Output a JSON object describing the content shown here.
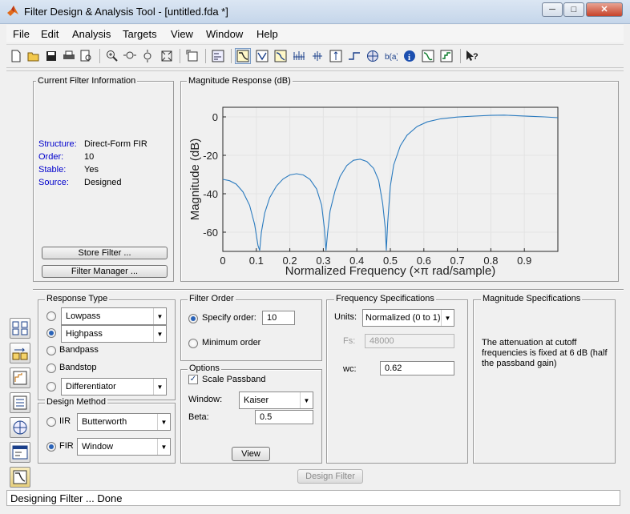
{
  "window": {
    "title": "Filter Design & Analysis Tool -  [untitled.fda *]",
    "controls": [
      "─",
      "□",
      "✕"
    ]
  },
  "menu": [
    "File",
    "Edit",
    "Analysis",
    "Targets",
    "View",
    "Window",
    "Help"
  ],
  "toolbar_icons": [
    "new-icon",
    "open-icon",
    "save-icon",
    "print-icon",
    "print-preview-icon",
    "zoom-in-icon",
    "zoom-x-icon",
    "zoom-y-icon",
    "full-view-icon",
    "new-figure-icon",
    "filter-spec-icon",
    "magnitude-response-icon",
    "phase-response-icon",
    "mag-phase-icon",
    "group-delay-icon",
    "phase-delay-icon",
    "impulse-response-icon",
    "step-response-icon",
    "pole-zero-icon",
    "coefficients-icon",
    "information-icon",
    "round-off-noise-icon",
    "magnitude-estimate-icon",
    "whats-this-icon"
  ],
  "current_filter": {
    "title": "Current Filter Information",
    "fields": [
      {
        "label": "Structure:",
        "value": "Direct-Form FIR"
      },
      {
        "label": "Order:",
        "value": "10"
      },
      {
        "label": "Stable:",
        "value": "Yes"
      },
      {
        "label": "Source:",
        "value": "Designed"
      }
    ],
    "store_button": "Store Filter ...",
    "manager_button": "Filter Manager ..."
  },
  "plot_panel": {
    "title": "Magnitude Response (dB)"
  },
  "chart_data": {
    "type": "line",
    "xlabel": "Normalized Frequency (×π rad/sample)",
    "ylabel": "Magnitude (dB)",
    "xlim": [
      0,
      1
    ],
    "ylim": [
      -70,
      5
    ],
    "xticks": [
      "0",
      "0.1",
      "0.2",
      "0.3",
      "0.4",
      "0.5",
      "0.6",
      "0.7",
      "0.8",
      "0.9"
    ],
    "xtick_values": [
      0,
      0.1,
      0.2,
      0.3,
      0.4,
      0.5,
      0.6,
      0.7,
      0.8,
      0.9
    ],
    "yticks": [
      "0",
      "-20",
      "-40",
      "-60"
    ],
    "ytick_values": [
      0,
      -20,
      -40,
      -60
    ],
    "grid": true,
    "color": "#2b7bbf",
    "x": [
      0,
      0.02,
      0.04,
      0.06,
      0.08,
      0.095,
      0.105,
      0.11,
      0.115,
      0.125,
      0.14,
      0.16,
      0.18,
      0.2,
      0.22,
      0.24,
      0.26,
      0.28,
      0.295,
      0.303,
      0.308,
      0.313,
      0.32,
      0.335,
      0.35,
      0.37,
      0.39,
      0.41,
      0.43,
      0.45,
      0.465,
      0.477,
      0.485,
      0.488,
      0.492,
      0.5,
      0.51,
      0.53,
      0.55,
      0.58,
      0.61,
      0.65,
      0.7,
      0.75,
      0.8,
      0.84,
      0.88,
      0.92,
      0.96,
      1.0
    ],
    "y": [
      -32.5,
      -33.2,
      -35.0,
      -39.0,
      -46.0,
      -56.0,
      -67.0,
      -69.5,
      -60.0,
      -50.0,
      -42.0,
      -36.0,
      -32.3,
      -30.2,
      -29.6,
      -30.2,
      -32.5,
      -37.5,
      -46.0,
      -58.0,
      -69.5,
      -60.0,
      -49.0,
      -38.5,
      -31.0,
      -25.3,
      -22.6,
      -22.0,
      -23.2,
      -26.8,
      -33.0,
      -45.0,
      -58.0,
      -69.5,
      -55.0,
      -36.0,
      -25.0,
      -15.0,
      -9.5,
      -5.0,
      -2.6,
      -1.0,
      -0.1,
      0.4,
      0.8,
      0.9,
      0.6,
      0.3,
      0.0,
      -0.4
    ]
  },
  "response_type": {
    "title": "Response Type",
    "options": [
      {
        "label": "Lowpass",
        "kind": "dropdown",
        "checked": false
      },
      {
        "label": "Highpass",
        "kind": "dropdown",
        "checked": true
      },
      {
        "label": "Bandpass",
        "kind": "label",
        "checked": false
      },
      {
        "label": "Bandstop",
        "kind": "label",
        "checked": false
      },
      {
        "label": "Differentiator",
        "kind": "dropdown",
        "checked": false
      }
    ]
  },
  "design_method": {
    "title": "Design Method",
    "iir_label": "IIR",
    "iir_value": "Butterworth",
    "fir_label": "FIR",
    "fir_value": "Window",
    "selected": "FIR"
  },
  "filter_order": {
    "title": "Filter Order",
    "specify_label": "Specify order:",
    "specify_value": "10",
    "minimum_label": "Minimum order",
    "selected": "specify"
  },
  "options": {
    "title": "Options",
    "scale_label": "Scale Passband",
    "scale_checked": true,
    "window_label": "Window:",
    "window_value": "Kaiser",
    "beta_label": "Beta:",
    "beta_value": "0.5",
    "view_button": "View"
  },
  "frequency_specs": {
    "title": "Frequency Specifications",
    "units_label": "Units:",
    "units_value": "Normalized (0 to 1)",
    "fs_label": "Fs:",
    "fs_value": "48000",
    "wc_label": "wc:",
    "wc_value": "0.62"
  },
  "magnitude_specs": {
    "title": "Magnitude Specifications",
    "text": "The attenuation at cutoff frequencies is fixed at 6 dB (half the passband gain)"
  },
  "design_button": "Design Filter",
  "status": "Designing Filter ... Done"
}
